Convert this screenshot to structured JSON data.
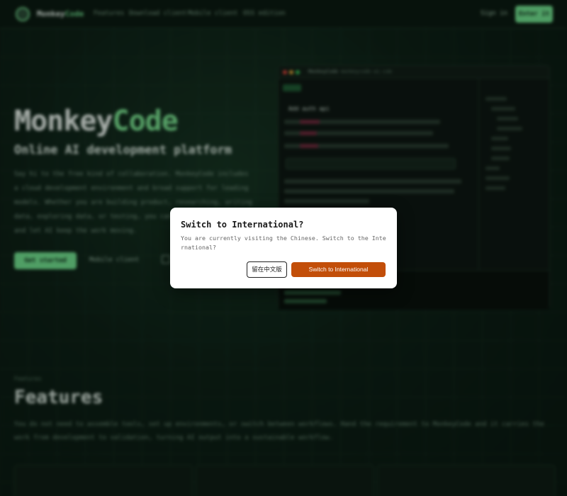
{
  "nav": {
    "logo_prefix": "Monkey",
    "logo_accent": "Code",
    "links": [
      "Features",
      "Download client",
      "Mobile client",
      "OSS edition"
    ],
    "signin": "Sign in",
    "cta": "Enter it"
  },
  "hero": {
    "title_prefix": "Monkey",
    "title_accent": "Code",
    "subtitle": "Online AI development platform",
    "description": "Say hi to the free kind of collaboration. MonkeyCode includes a cloud development environment and broad support for leading models. Whether you are building product, researching, writing data, exploring data, or testing, you can do it in the browser and let AI keep the work moving.",
    "primary_button": "Get started",
    "secondary_button": "Mobile client"
  },
  "preview": {
    "window_title": "MonkeyCode",
    "url": "monkeycode-ai.com",
    "file_header": "Add auth api"
  },
  "features": {
    "kicker": "Features",
    "title": "Features",
    "description": "You do not need to assemble tools, set up environments, or switch between workflows. Hand the requirement to MonkeyCode and it carries the work from development to validation, turning AI output into a sustainable workflow."
  },
  "modal": {
    "title": "Switch to International?",
    "body": "You are currently visiting the Chinese. Switch to the International?",
    "stay_button": "留在中文版",
    "switch_button": "Switch to International"
  },
  "colors": {
    "accent": "#6fdc8c",
    "switch_button": "#c24e09",
    "background": "#0c1a12"
  }
}
